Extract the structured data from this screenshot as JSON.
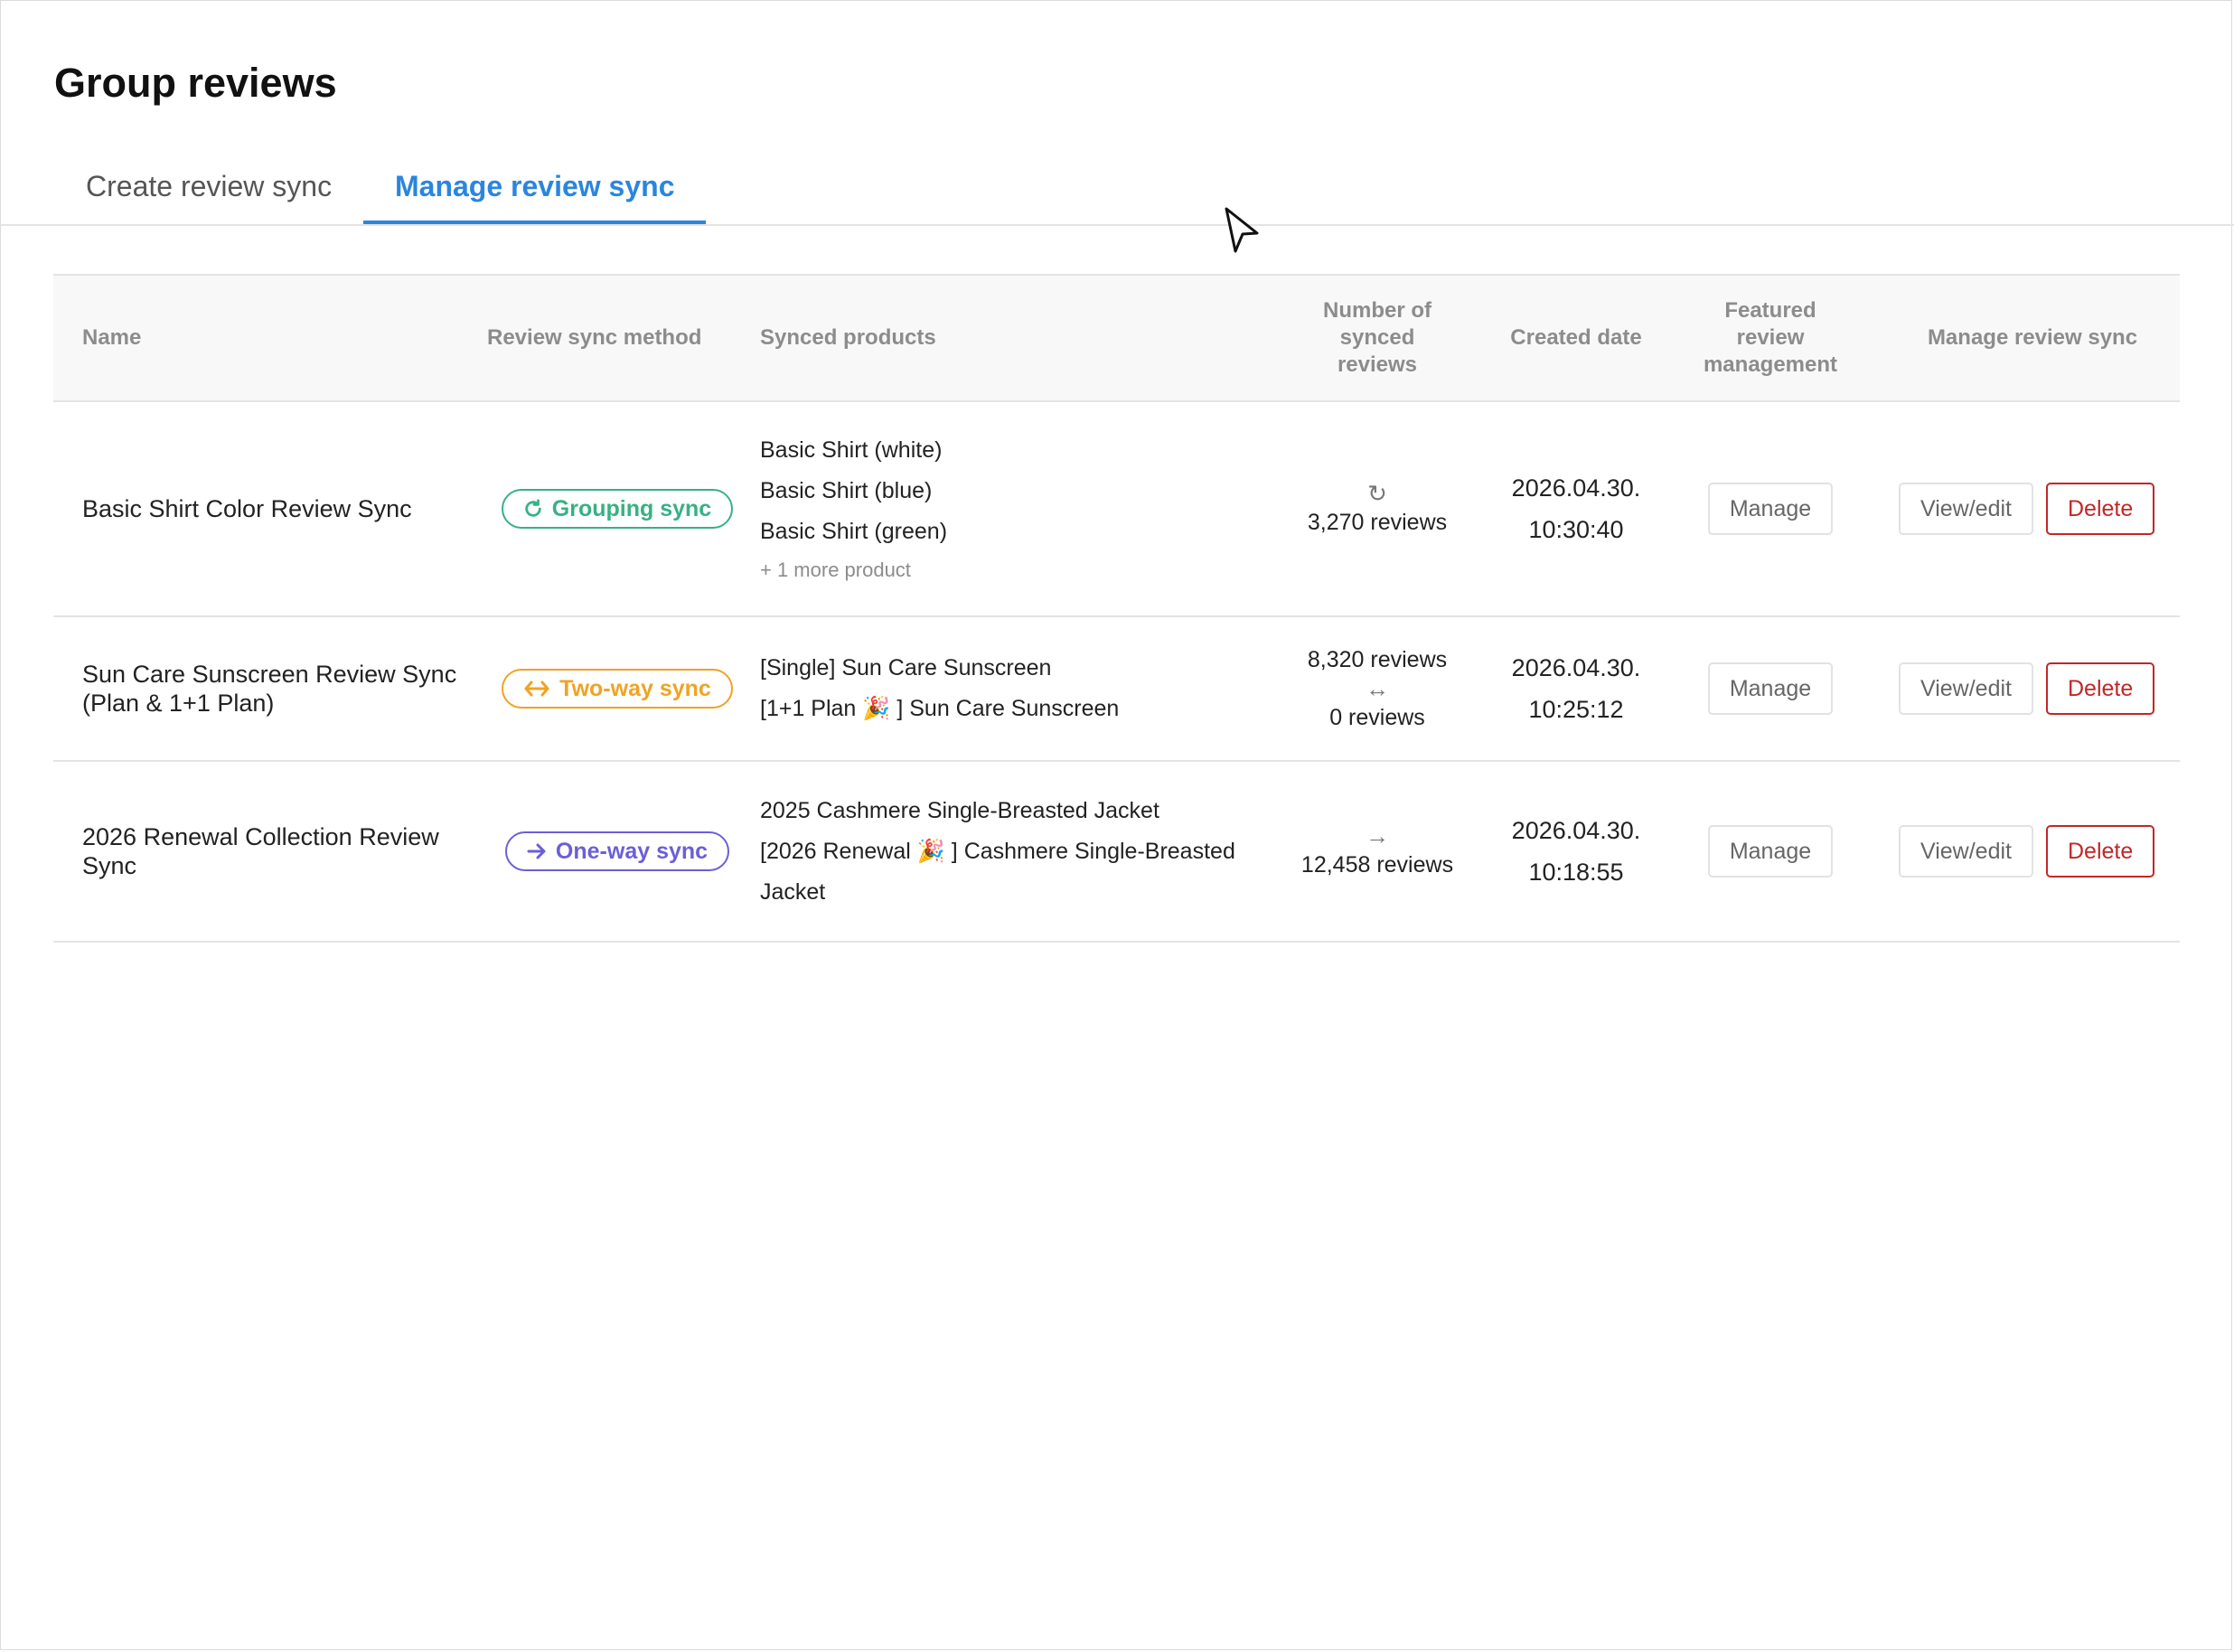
{
  "page": {
    "title": "Group reviews"
  },
  "tabs": [
    {
      "label": "Create review sync",
      "active": false
    },
    {
      "label": "Manage review sync",
      "active": true
    }
  ],
  "table": {
    "headers": {
      "name": "Name",
      "method": "Review sync method",
      "products": "Synced products",
      "count": "Number of synced reviews",
      "created": "Created date",
      "featured": "Featured review management",
      "manage": "Manage review sync"
    },
    "rows": [
      {
        "name": "Basic Shirt Color Review Sync",
        "method": {
          "label": "Grouping sync",
          "icon": "refresh-icon",
          "color": "#37b184"
        },
        "products": [
          "Basic Shirt (white)",
          "Basic Shirt (blue)",
          "Basic Shirt (green)"
        ],
        "more": "+ 1 more product",
        "count_top": "",
        "symbol": "↻",
        "count_bottom": "3,270 reviews",
        "date": "2026.04.30.",
        "time": "10:30:40",
        "featured_btn": "Manage",
        "view_btn": "View/edit",
        "delete_btn": "Delete"
      },
      {
        "name": "Sun Care Sunscreen Review Sync (Plan & 1+1 Plan)",
        "method": {
          "label": "Two-way sync",
          "icon": "two-way-arrow-icon",
          "color": "#f0a323"
        },
        "products": [
          "[Single] Sun Care Sunscreen",
          "[1+1 Plan 🎉 ] Sun Care Sunscreen"
        ],
        "more": "",
        "count_top": "8,320 reviews",
        "symbol": "↔",
        "count_bottom": "0 reviews",
        "date": "2026.04.30.",
        "time": "10:25:12",
        "featured_btn": "Manage",
        "view_btn": "View/edit",
        "delete_btn": "Delete"
      },
      {
        "name": "2026 Renewal Collection Review Sync",
        "method": {
          "label": "One-way sync",
          "icon": "arrow-right-icon",
          "color": "#6a5fd8"
        },
        "products": [
          "2025 Cashmere Single-Breasted Jacket",
          "[2026 Renewal 🎉 ] Cashmere Single-Breasted",
          "Jacket"
        ],
        "more": "",
        "count_top": "",
        "symbol": "→",
        "count_bottom": "12,458 reviews",
        "date": "2026.04.30.",
        "time": "10:18:55",
        "featured_btn": "Manage",
        "view_btn": "View/edit",
        "delete_btn": "Delete"
      }
    ]
  }
}
